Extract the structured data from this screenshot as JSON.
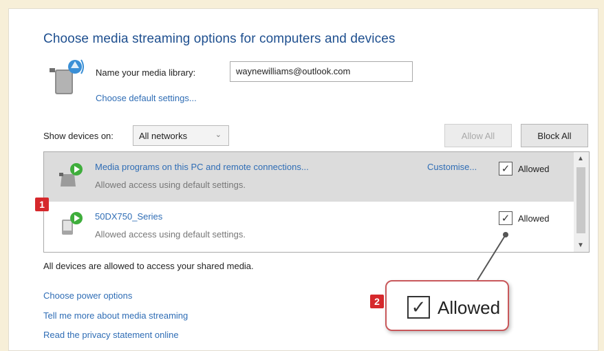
{
  "heading": "Choose media streaming options for computers and devices",
  "library": {
    "label": "Name your media library:",
    "value": "waynewilliams@outlook.com",
    "defaults_link": "Choose default settings..."
  },
  "filter": {
    "label": "Show devices on:",
    "selected": "All networks"
  },
  "buttons": {
    "allow_all": "Allow All",
    "block_all": "Block All"
  },
  "devices": [
    {
      "name": "Media programs on this PC and remote connections...",
      "subtitle": "Allowed access using default settings.",
      "customise": "Customise...",
      "allowed_label": "Allowed",
      "checked": true
    },
    {
      "name": "50DX750_Series",
      "subtitle": "Allowed access using default settings.",
      "allowed_label": "Allowed",
      "checked": true
    }
  ],
  "status": "All devices are allowed to access your shared media.",
  "links": [
    "Choose power options",
    "Tell me more about media streaming",
    "Read the privacy statement online"
  ],
  "badges": [
    "1",
    "2"
  ],
  "callout": {
    "label": "Allowed",
    "checked": true
  },
  "colors": {
    "heading": "#1e4f8f",
    "link": "#2f6db5",
    "badge": "#d6282c",
    "callout_border": "#c8575a"
  }
}
